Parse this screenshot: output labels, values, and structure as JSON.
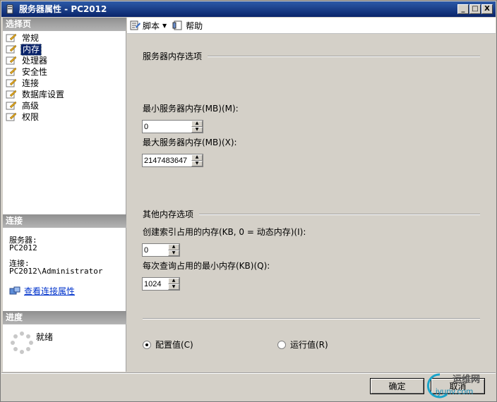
{
  "window": {
    "title": "服务器属性 - PC2012",
    "min_label": "_",
    "max_label": "□",
    "close_label": "X"
  },
  "left_pane": {
    "select_page_header": "选择页",
    "nav_items": [
      {
        "label": "常规",
        "selected": false
      },
      {
        "label": "内存",
        "selected": true
      },
      {
        "label": "处理器",
        "selected": false
      },
      {
        "label": "安全性",
        "selected": false
      },
      {
        "label": "连接",
        "selected": false
      },
      {
        "label": "数据库设置",
        "selected": false
      },
      {
        "label": "高级",
        "selected": false
      },
      {
        "label": "权限",
        "selected": false
      }
    ],
    "connection_header": "连接",
    "server_label": "服务器:",
    "server_value": "PC2012",
    "connection_label": "连接:",
    "connection_value": "PC2012\\Administrator",
    "view_connection_link": "查看连接属性",
    "progress_header": "进度",
    "progress_status": "就绪"
  },
  "toolbar": {
    "script_label": "脚本",
    "help_label": "帮助"
  },
  "memory": {
    "server_memory_group": "服务器内存选项",
    "min_server_memory_label": "最小服务器内存(MB)(M):",
    "min_server_memory_value": "0",
    "max_server_memory_label": "最大服务器内存(MB)(X):",
    "max_server_memory_value": "2147483647",
    "other_memory_group": "其他内存选项",
    "index_memory_label": "创建索引占用的内存(KB, 0 = 动态内存)(I):",
    "index_memory_value": "0",
    "min_query_memory_label": "每次查询占用的最小内存(KB)(Q):",
    "min_query_memory_value": "1024",
    "configured_values_label": "配置值(C)",
    "running_values_label": "运行值(R)",
    "selected_mode": "configured"
  },
  "buttons": {
    "ok_label": "确定",
    "cancel_label": "取消"
  },
  "watermark": {
    "text": "运维网",
    "domain": "iyunv.com"
  },
  "colors": {
    "title_bar": "#0a246a",
    "selected_item": "#0a246a",
    "link": "#0033cc",
    "dialog_bg": "#d4d0c8"
  }
}
